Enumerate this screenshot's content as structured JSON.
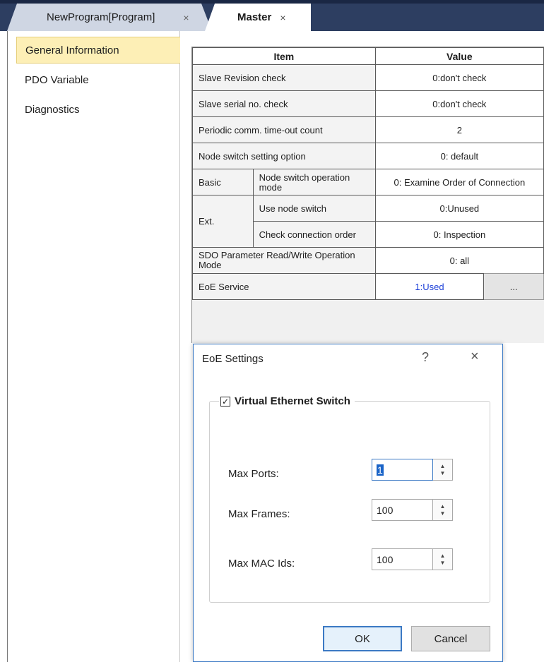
{
  "tabs": [
    {
      "label": "NewProgram[Program]",
      "close": "×"
    },
    {
      "label": "Master",
      "close": "×"
    }
  ],
  "sidebar": {
    "items": [
      {
        "label": "General Information",
        "selected": true
      },
      {
        "label": "PDO Variable",
        "selected": false
      },
      {
        "label": "Diagnostics",
        "selected": false
      }
    ]
  },
  "grid": {
    "headers": {
      "item": "Item",
      "value": "Value"
    },
    "rows": {
      "r1": {
        "item": "Slave Revision check",
        "value": "0:don't check"
      },
      "r2": {
        "item": "Slave serial no. check",
        "value": "0:don't check"
      },
      "r3": {
        "item": "Periodic comm. time-out count",
        "value": "2"
      },
      "r4": {
        "item": "Node switch setting option",
        "value": "0: default"
      },
      "r5": {
        "group": "Basic",
        "item": "Node switch operation mode",
        "value": "0: Examine Order of Connection"
      },
      "r6": {
        "group": "Ext.",
        "item": "Use node switch",
        "value": "0:Unused"
      },
      "r7": {
        "item": "Check connection order",
        "value": "0: Inspection"
      },
      "r8": {
        "item": "SDO Parameter Read/Write Operation Mode",
        "value": "0: all"
      },
      "r9": {
        "item": "EoE Service",
        "value": "1:Used",
        "button": "..."
      }
    }
  },
  "dialog": {
    "title": "EoE Settings",
    "help": "?",
    "close": "×",
    "group_label": "Virtual Ethernet Switch",
    "group_checked": true,
    "fields": {
      "max_ports": {
        "label": "Max Ports:",
        "value": "1"
      },
      "max_frames": {
        "label": "Max Frames:",
        "value": "100"
      },
      "max_mac_ids": {
        "label": "Max MAC Ids:",
        "value": "100"
      }
    },
    "ok_label": "OK",
    "cancel_label": "Cancel"
  },
  "colors": {
    "tab_strip": "#2d3e61",
    "selected_item": "#fdefb6",
    "dialog_border": "#3b79c4",
    "eoe_value": "#1c3fd8"
  }
}
